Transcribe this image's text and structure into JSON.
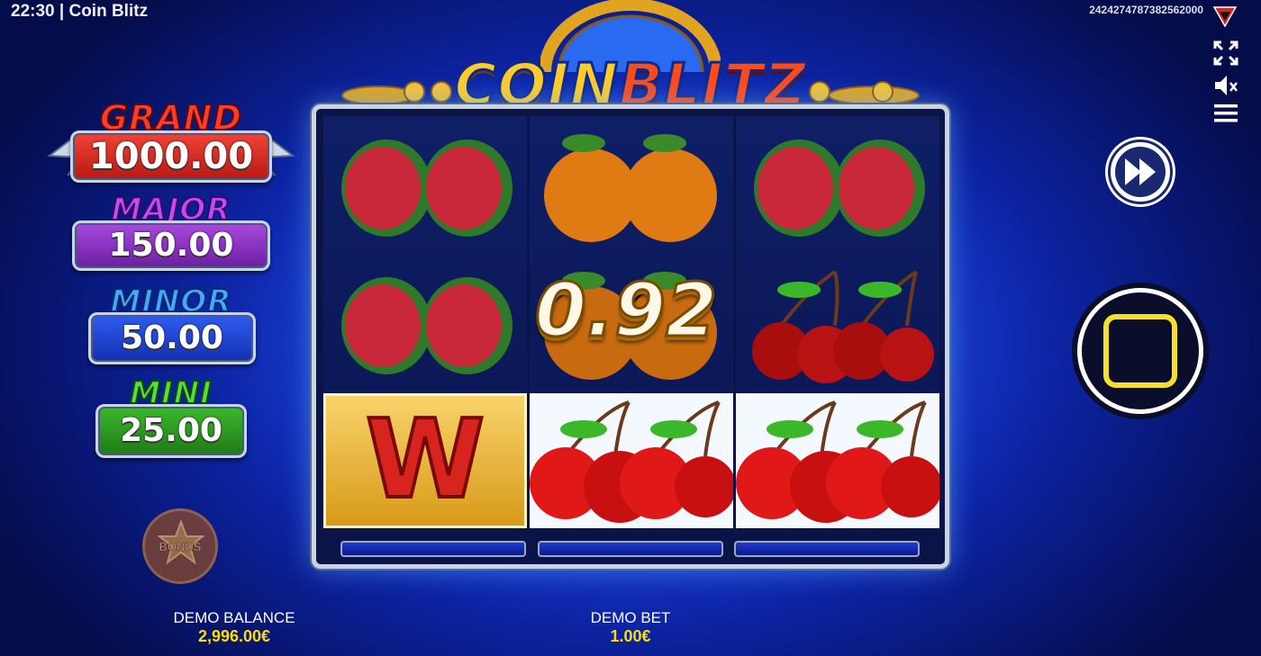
{
  "status_bar": {
    "clock_title": "22:30 | Coin Blitz",
    "session_id": "242427478738256200​0"
  },
  "side_controls": {
    "fullscreen_icon": "fullscreen-icon",
    "sound_icon": "sound-muted-icon",
    "menu_icon": "hamburger-menu-icon"
  },
  "logo": {
    "word1": "COIN",
    "word2": "BLITZ"
  },
  "jackpots": [
    {
      "name": "GRAND",
      "value": "1000.00",
      "color": "#d8261e",
      "name_color": "#ff3b2a"
    },
    {
      "name": "MAJOR",
      "value": "150.00",
      "color": "#8a2cc4",
      "name_color": "#c04aff"
    },
    {
      "name": "MINOR",
      "value": "50.00",
      "color": "#1d44d8",
      "name_color": "#44a8ff"
    },
    {
      "name": "MINI",
      "value": "25.00",
      "color": "#2e9a22",
      "name_color": "#5cdc3a"
    }
  ],
  "reels": [
    [
      "watermelon",
      "watermelon",
      "wild"
    ],
    [
      "orange",
      "orange",
      "cherry"
    ],
    [
      "watermelon",
      "cherry",
      "cherry"
    ]
  ],
  "win": {
    "amount": "0.92"
  },
  "wild_letter": "W",
  "bonus": {
    "label": "BONUS"
  },
  "footer": {
    "balance_label": "DEMO BALANCE",
    "balance_value": "2,996.00€",
    "bet_label": "DEMO BET",
    "bet_value": "1.00€"
  }
}
